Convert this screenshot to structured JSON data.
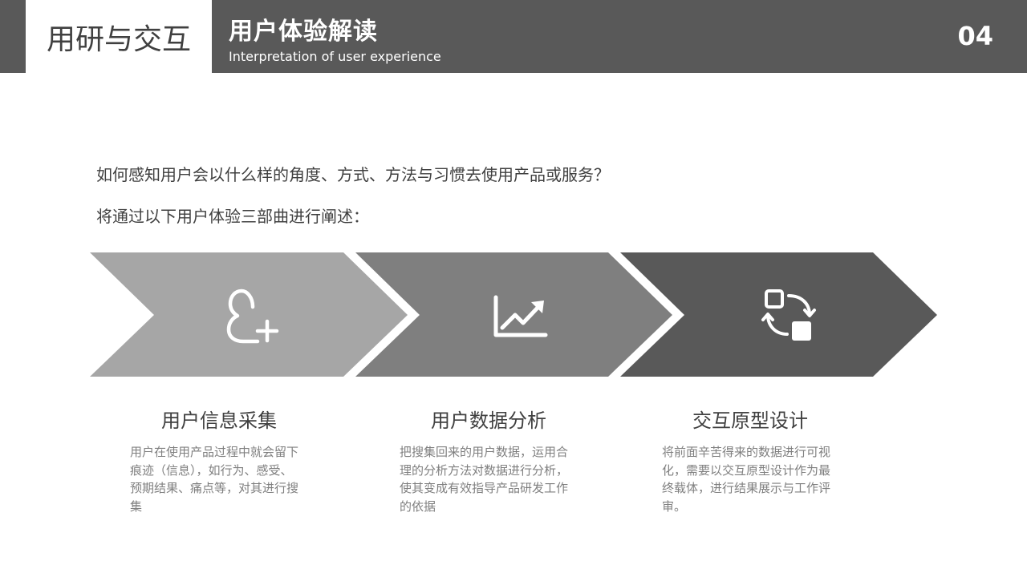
{
  "header": {
    "section": "用研与交互",
    "title": "用户体验解读",
    "subtitle": "Interpretation of user experience",
    "page_number": "04"
  },
  "intro": {
    "line1": "如何感知用户会以什么样的角度、方式、方法与习惯去使用产品或服务？",
    "line2": "将通过以下用户体验三部曲进行阐述："
  },
  "steps": [
    {
      "title": "用户信息采集",
      "description": "用户在使用产品过程中就会留下痕迹（信息），如行为、感受、预期结果、痛点等，对其进行搜集",
      "icon": "user-add-icon",
      "color": "#a6a6a6"
    },
    {
      "title": "用户数据分析",
      "description": "把搜集回来的用户数据，运用合理的分析方法对数据进行分析，使其变成有效指导产品研发工作的依据",
      "icon": "chart-trend-icon",
      "color": "#7f7f7f"
    },
    {
      "title": "交互原型设计",
      "description": "将前面辛苦得来的数据进行可视化，需要以交互原型设计作为最终载体，进行结果展示与工作评审。",
      "icon": "transform-icon",
      "color": "#595959"
    }
  ]
}
